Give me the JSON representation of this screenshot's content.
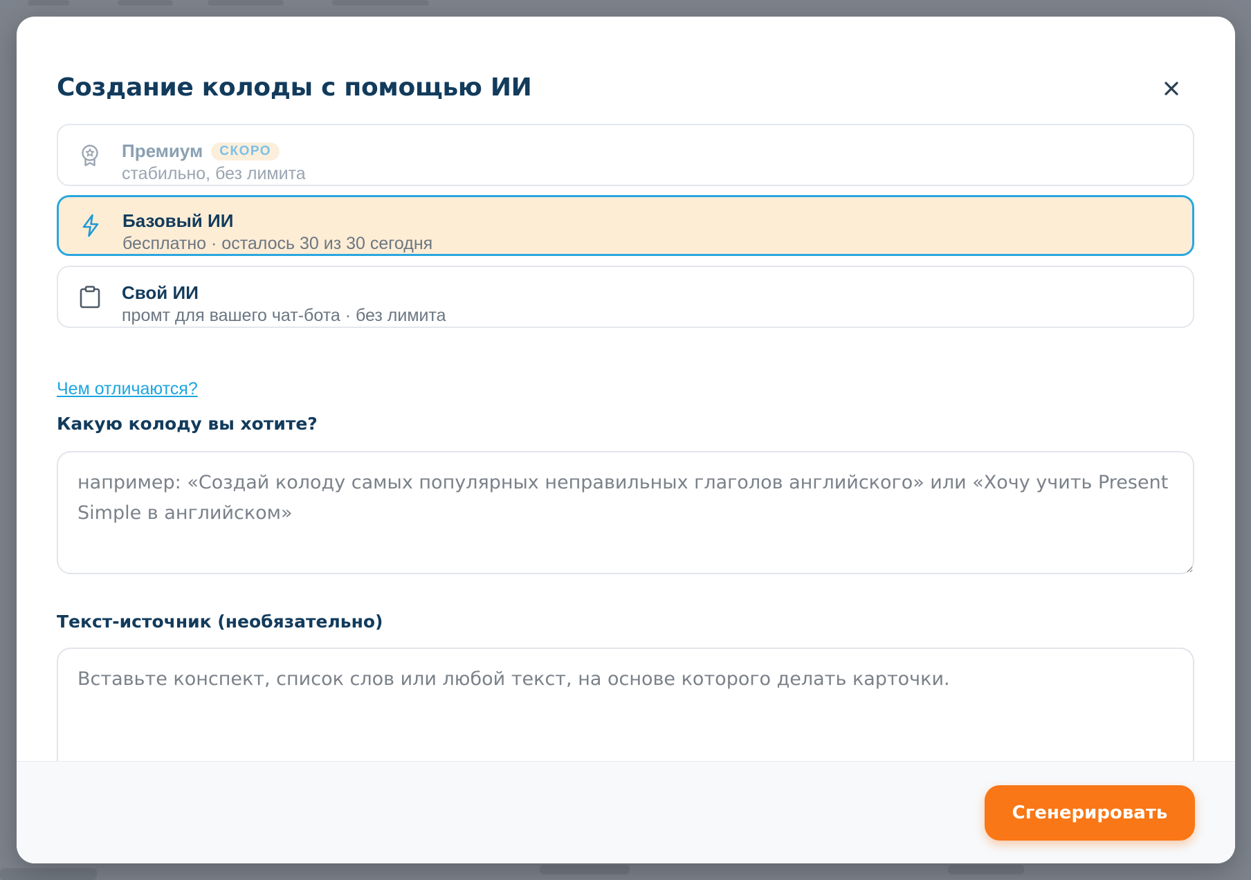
{
  "modal": {
    "title": "Создание колоды с помощью ИИ"
  },
  "options": [
    {
      "title": "Премиум",
      "badge": "СКОРО",
      "subtitle": "стабильно, без лимита",
      "icon": "award-icon",
      "state": "disabled"
    },
    {
      "title": "Базовый ИИ",
      "subtitle": "бесплатно · осталось 30 из 30 сегодня",
      "icon": "lightning-icon",
      "state": "selected"
    },
    {
      "title": "Свой ИИ",
      "subtitle": "промт для вашего чат-бота · без лимита",
      "icon": "clipboard-icon",
      "state": "default"
    }
  ],
  "help_link": "Чем отличаются?",
  "deck_field": {
    "label": "Какую колоду вы хотите?",
    "placeholder": "например: «Создай колоду самых популярных неправильных глаголов английского» или «Хочу учить Present Simple в английском»",
    "value": ""
  },
  "source_field": {
    "label": "Текст-источник (необязательно)",
    "placeholder": "Вставьте конспект, список слов или любой текст, на основе которого делать карточки.",
    "value": ""
  },
  "footer": {
    "generate_label": "Сгенерировать"
  },
  "colors": {
    "accent": "#f97716",
    "selected_bg": "#feedd5",
    "selected_border": "#29a7df",
    "title": "#123b5c",
    "link": "#1ba6e0"
  }
}
